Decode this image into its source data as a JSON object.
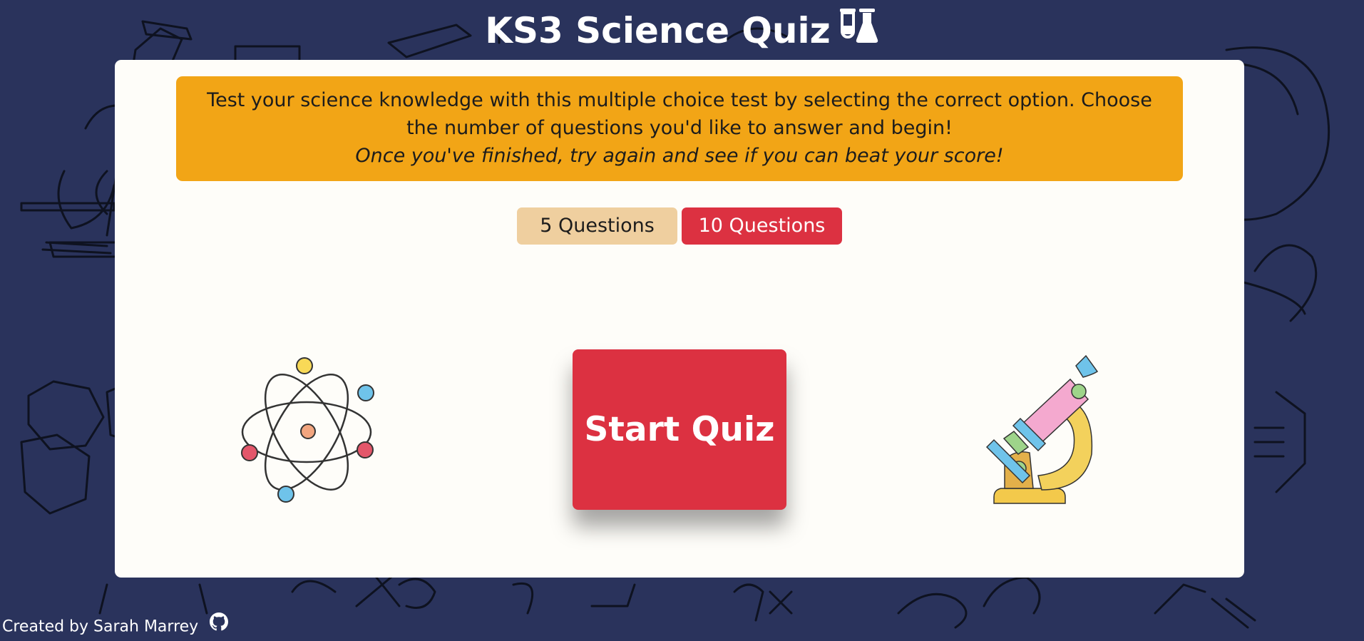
{
  "page": {
    "title": "KS3 Science Quiz",
    "title_icon": "flask-icon"
  },
  "intro": {
    "description": "Test your science knowledge with this multiple choice test by selecting the correct option. Choose the number of questions you'd like to answer and begin!",
    "tagline": "Once you've finished, try again and see if you can beat your score!"
  },
  "question_options": [
    {
      "label": "5 Questions",
      "selected": false
    },
    {
      "label": "10 Questions",
      "selected": true
    }
  ],
  "start_button": {
    "label": "Start Quiz"
  },
  "illustrations": {
    "left": "atom-icon",
    "right": "microscope-icon"
  },
  "footer": {
    "credit": "Created by Sarah Marrey",
    "link_icon": "github-icon"
  },
  "colors": {
    "background": "#2a335c",
    "card": "#fefdf9",
    "intro_banner": "#f2a516",
    "unselected_option": "#efcf9f",
    "accent_red": "#dc3141"
  }
}
